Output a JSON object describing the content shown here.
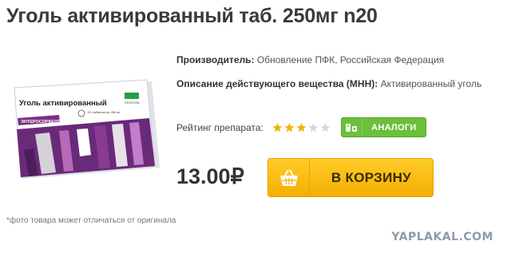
{
  "product": {
    "title": "Уголь активированный таб. 250мг n20"
  },
  "info": {
    "manufacturer_label": "Производитель:",
    "manufacturer_value": "Обновление ПФК, Российская Федерация",
    "substance_label": "Описание действующего вещества (МНН):",
    "substance_value": "Активированный уголь"
  },
  "rating": {
    "label": "Рейтинг препарата:",
    "value": 3,
    "max": 5,
    "filled_color": "#f1b400",
    "empty_color": "#d8d8d8"
  },
  "analogs": {
    "label": "АНАЛОГИ",
    "icon": "pills-icon",
    "color": "#6bbf3a"
  },
  "price": {
    "value": "13.00₽"
  },
  "cart": {
    "label": "В КОРЗИНУ",
    "icon": "basket-icon",
    "color": "#f9bd10"
  },
  "image_box": {
    "title": "Уголь активированный",
    "tag": "ЭНТЕРОСОРБЕНТ",
    "brand": "RENEWAL",
    "caption": "20 таблеток по 250 мг"
  },
  "note": "*фото товара может отличаться от оригинала",
  "watermark": "YAPLAKAL.COM"
}
